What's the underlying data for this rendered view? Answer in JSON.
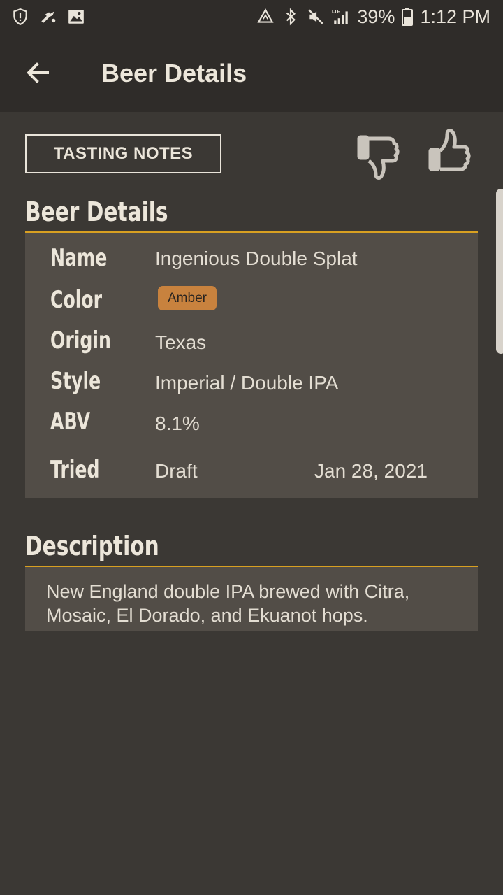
{
  "status_bar": {
    "battery": "39%",
    "time": "1:12 PM",
    "icons_left": [
      "shield-alert-icon",
      "untappd-icon",
      "image-icon"
    ],
    "icons_right": [
      "nfc-icon",
      "bluetooth-icon",
      "mute-icon",
      "lte-signal-icon",
      "battery-icon"
    ]
  },
  "app_bar": {
    "title": "Beer Details",
    "back_icon": "arrow-left-icon"
  },
  "actions": {
    "tasting_notes_label": "TASTING NOTES",
    "thumbs_down_icon": "thumbs-down-icon",
    "thumbs_up_icon": "thumbs-up-icon"
  },
  "details": {
    "heading": "Beer Details",
    "rows": {
      "name": {
        "label": "Name",
        "value": "Ingenious Double Splat"
      },
      "color": {
        "label": "Color",
        "value": "Amber"
      },
      "origin": {
        "label": "Origin",
        "value": "Texas"
      },
      "style": {
        "label": "Style",
        "value": "Imperial / Double IPA"
      },
      "abv": {
        "label": "ABV",
        "value": "8.1%"
      },
      "tried": {
        "label": "Tried",
        "value": "Draft",
        "date": "Jan 28, 2021"
      }
    }
  },
  "description": {
    "heading": "Description",
    "text": "New England double IPA brewed with Citra, Mosaic, El Dorado, and Ekuanot hops."
  },
  "colors": {
    "background": "#3b3834",
    "bar": "#2f2c29",
    "panel": "#524d47",
    "accent_rule": "#d8a021",
    "amber_badge": "#c8823e"
  }
}
